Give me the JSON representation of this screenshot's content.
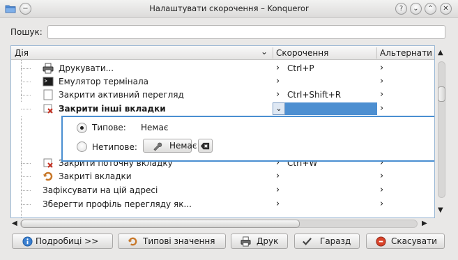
{
  "window": {
    "title": "Налаштувати скорочення – Konqueror"
  },
  "search": {
    "label": "Пошук:",
    "value": "",
    "placeholder": ""
  },
  "table": {
    "columns": [
      "Дія",
      "Скорочення",
      "Альтернати"
    ],
    "rows": [
      {
        "label": "Друкувати...",
        "shortcut": "Ctrl+P",
        "icon": "printer-icon"
      },
      {
        "label": "Емулятор термінала",
        "shortcut": "",
        "icon": "terminal-icon"
      },
      {
        "label": "Закрити активний перегляд",
        "shortcut": "Ctrl+Shift+R",
        "icon": "blank-doc-icon"
      },
      {
        "label": "Закрити інші вкладки",
        "shortcut": "",
        "icon": "close-tabs-icon",
        "selected": true
      },
      {
        "label": "Закрити поточну вкладку",
        "shortcut": "Ctrl+W",
        "icon": "close-tab-icon"
      },
      {
        "label": "Закриті вкладки",
        "shortcut": "",
        "icon": "undo-closed-icon"
      },
      {
        "label": "Зафіксувати на цій адресі",
        "shortcut": "",
        "icon": ""
      },
      {
        "label": "Зберегти профіль перегляду як...",
        "shortcut": "",
        "icon": ""
      }
    ]
  },
  "editor": {
    "default_label": "Типове:",
    "default_value": "Немає",
    "custom_label": "Нетипове:",
    "custom_button": "Немає"
  },
  "buttons": {
    "details": "Подробиці >>",
    "defaults": "Типові значення",
    "print": "Друк",
    "ok": "Гаразд",
    "cancel": "Скасувати"
  },
  "colors": {
    "selection": "#4d8fd1",
    "border_focus": "#4a8fd1"
  }
}
